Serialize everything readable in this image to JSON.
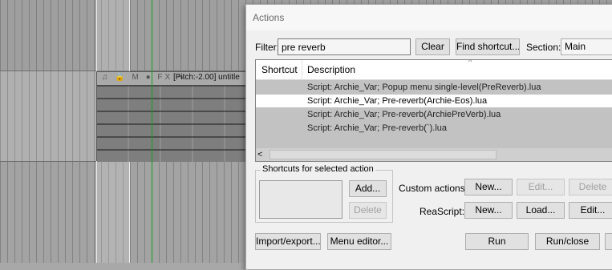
{
  "arrange": {
    "item_take_name": "[Pitch:-2.00] untitle",
    "item_icons": "♫ 🔒 M ● FX ∿"
  },
  "dialog": {
    "title": "Actions",
    "filter_label": "Filter:",
    "filter_value": "pre reverb",
    "clear_label": "Clear",
    "find_shortcut_label": "Find shortcut...",
    "section_label": "Section:",
    "section_value": "Main",
    "list": {
      "col_shortcut": "Shortcut",
      "col_description": "Description",
      "sort_indicator": "^",
      "rows": [
        {
          "shortcut": "",
          "description": "Script: Archie_Var;  Popup menu single-level(PreReverb).lua",
          "selected": false
        },
        {
          "shortcut": "",
          "description": "Script: Archie_Var;  Pre-reverb(Archie-Eos).lua",
          "selected": true
        },
        {
          "shortcut": "",
          "description": "Script: Archie_Var;  Pre-reverb(ArchiePreVerb).lua",
          "selected": false
        },
        {
          "shortcut": "",
          "description": "Script: Archie_Var;  Pre-reverb(`).lua",
          "selected": false
        }
      ],
      "scroll_left_icon": "<"
    },
    "shortcuts_group_label": "Shortcuts for selected action",
    "add_label": "Add...",
    "delete_label": "Delete",
    "custom_actions_label": "Custom actions:",
    "custom_new_label": "New...",
    "custom_edit_label": "Edit...",
    "custom_delete_label": "Delete",
    "reascript_label": "ReaScript:",
    "reascript_new_label": "New...",
    "reascript_load_label": "Load...",
    "reascript_edit_label": "Edit...",
    "import_export_label": "Import/export...",
    "menu_editor_label": "Menu editor...",
    "run_label": "Run",
    "run_close_label": "Run/close"
  }
}
